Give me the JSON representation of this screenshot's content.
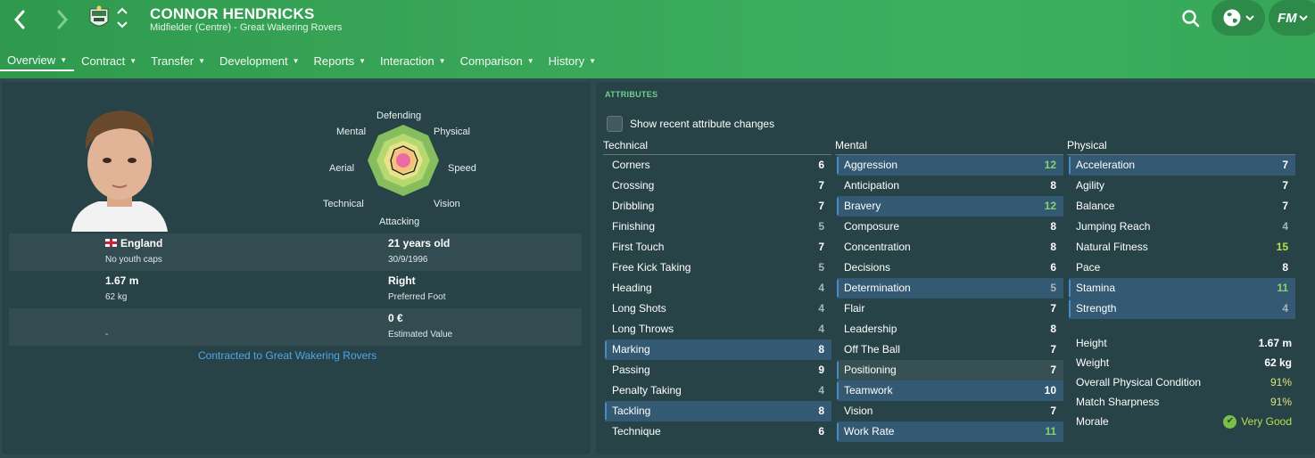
{
  "header": {
    "player_name": "CONNOR HENDRICKS",
    "player_subtitle": "Midfielder (Centre) - Great Wakering Rovers"
  },
  "tabs": [
    {
      "label": "Overview"
    },
    {
      "label": "Contract"
    },
    {
      "label": "Transfer"
    },
    {
      "label": "Development"
    },
    {
      "label": "Reports"
    },
    {
      "label": "Interaction"
    },
    {
      "label": "Comparison"
    },
    {
      "label": "History"
    }
  ],
  "radar": {
    "labels": {
      "defending": "Defending",
      "physical": "Physical",
      "speed": "Speed",
      "vision": "Vision",
      "attacking": "Attacking",
      "technical": "Technical",
      "aerial": "Aerial",
      "mental": "Mental"
    }
  },
  "profile": {
    "nationality": "England",
    "youth_caps": "No youth caps",
    "age": "21 years old",
    "dob": "30/9/1996",
    "height": "1.67 m",
    "weight": "62 kg",
    "foot": "Right",
    "foot_label": "Preferred Foot",
    "value": "0 €",
    "value_label": "Estimated Value",
    "dash": "-",
    "contract": "Contracted to Great Wakering Rovers"
  },
  "attributes": {
    "title": "ATTRIBUTES",
    "show_changes": "Show recent attribute changes",
    "technical": {
      "heading": "Technical",
      "items": [
        {
          "name": "Corners",
          "value": "6"
        },
        {
          "name": "Crossing",
          "value": "7"
        },
        {
          "name": "Dribbling",
          "value": "7"
        },
        {
          "name": "Finishing",
          "value": "5"
        },
        {
          "name": "First Touch",
          "value": "7"
        },
        {
          "name": "Free Kick Taking",
          "value": "5"
        },
        {
          "name": "Heading",
          "value": "4"
        },
        {
          "name": "Long Shots",
          "value": "4"
        },
        {
          "name": "Long Throws",
          "value": "4"
        },
        {
          "name": "Marking",
          "value": "8"
        },
        {
          "name": "Passing",
          "value": "9"
        },
        {
          "name": "Penalty Taking",
          "value": "4"
        },
        {
          "name": "Tackling",
          "value": "8"
        },
        {
          "name": "Technique",
          "value": "6"
        }
      ]
    },
    "mental": {
      "heading": "Mental",
      "items": [
        {
          "name": "Aggression",
          "value": "12"
        },
        {
          "name": "Anticipation",
          "value": "8"
        },
        {
          "name": "Bravery",
          "value": "12"
        },
        {
          "name": "Composure",
          "value": "8"
        },
        {
          "name": "Concentration",
          "value": "8"
        },
        {
          "name": "Decisions",
          "value": "6"
        },
        {
          "name": "Determination",
          "value": "5"
        },
        {
          "name": "Flair",
          "value": "7"
        },
        {
          "name": "Leadership",
          "value": "8"
        },
        {
          "name": "Off The Ball",
          "value": "7"
        },
        {
          "name": "Positioning",
          "value": "7"
        },
        {
          "name": "Teamwork",
          "value": "10"
        },
        {
          "name": "Vision",
          "value": "7"
        },
        {
          "name": "Work Rate",
          "value": "11"
        }
      ]
    },
    "physical": {
      "heading": "Physical",
      "items": [
        {
          "name": "Acceleration",
          "value": "7"
        },
        {
          "name": "Agility",
          "value": "7"
        },
        {
          "name": "Balance",
          "value": "7"
        },
        {
          "name": "Jumping Reach",
          "value": "4"
        },
        {
          "name": "Natural Fitness",
          "value": "15"
        },
        {
          "name": "Pace",
          "value": "8"
        },
        {
          "name": "Stamina",
          "value": "11"
        },
        {
          "name": "Strength",
          "value": "4"
        }
      ]
    },
    "stats": [
      {
        "name": "Height",
        "value": "1.67 m"
      },
      {
        "name": "Weight",
        "value": "62 kg"
      },
      {
        "name": "Overall Physical Condition",
        "value": "91%"
      },
      {
        "name": "Match Sharpness",
        "value": "91%"
      },
      {
        "name": "Morale",
        "value": "Very Good"
      }
    ]
  },
  "colors": {
    "header_green": "#3aa85a",
    "panel": "#28424a",
    "highlight_blue": "#386082",
    "value_green": "#86d46a",
    "value_grey": "#a8b4b8",
    "link_blue": "#4fa6e8",
    "section_title_green": "#6fd28a"
  },
  "icons": {
    "back": "chevron-left-icon",
    "forward": "chevron-right-icon",
    "search": "search-icon",
    "globe": "globe-icon",
    "fm": "fm-logo",
    "morale": "check-circle-icon"
  }
}
